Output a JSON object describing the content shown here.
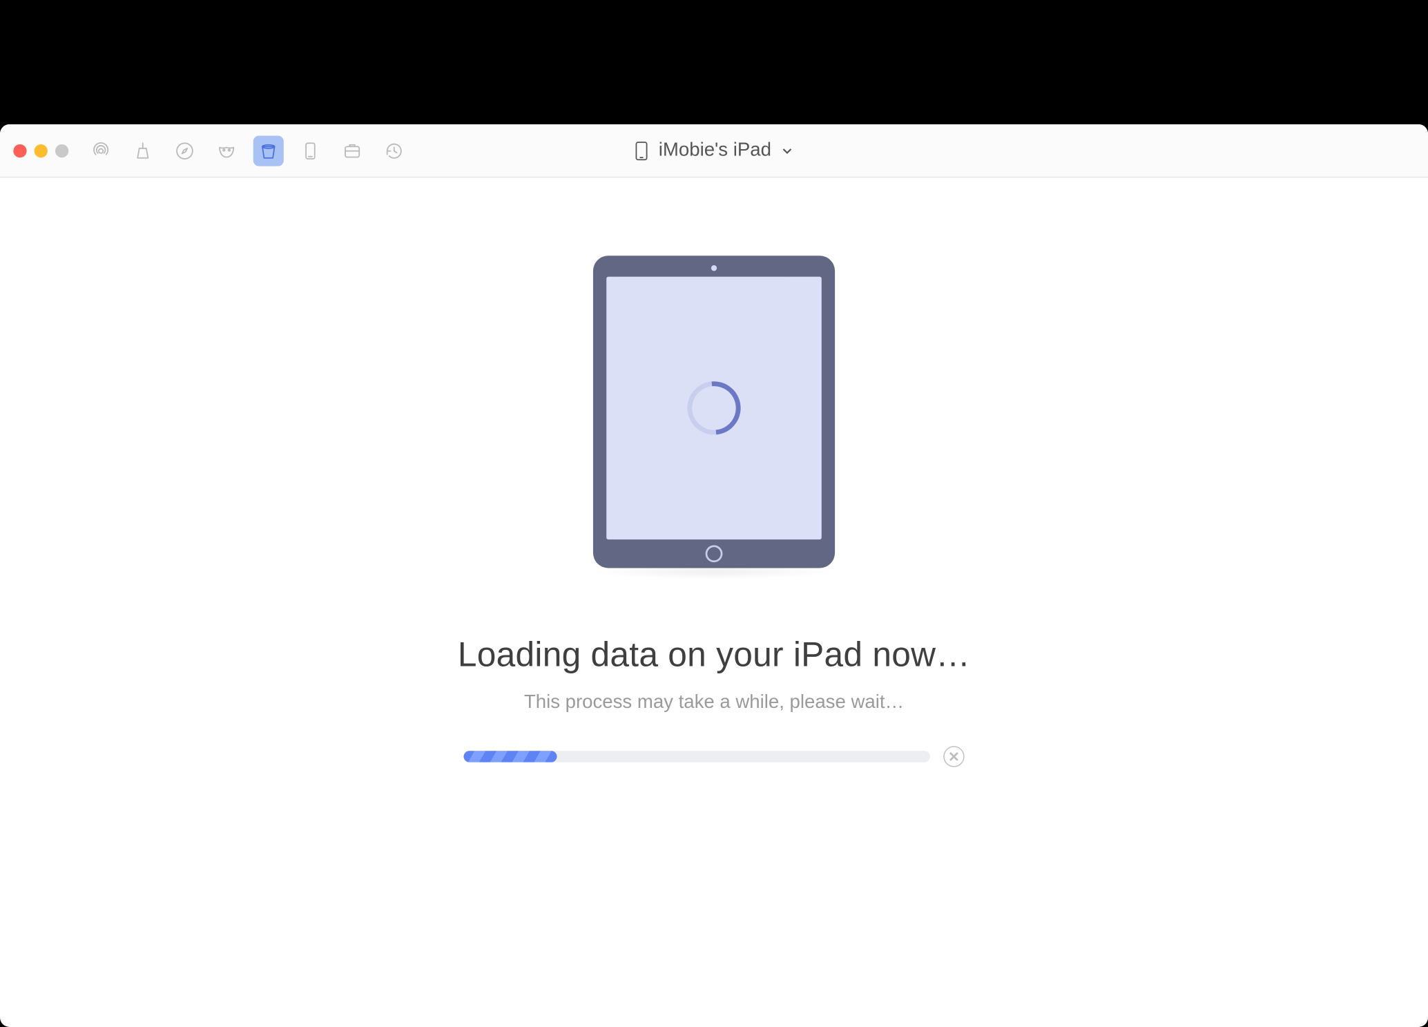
{
  "device": {
    "name": "iMobie's iPad"
  },
  "toolbar": {
    "icons": [
      {
        "id": "airdrop-icon",
        "selected": false
      },
      {
        "id": "clean-icon",
        "selected": false
      },
      {
        "id": "safari-icon",
        "selected": false
      },
      {
        "id": "mask-icon",
        "selected": false
      },
      {
        "id": "bucket-icon",
        "selected": true
      },
      {
        "id": "phone-icon",
        "selected": false
      },
      {
        "id": "archive-icon",
        "selected": false
      },
      {
        "id": "history-icon",
        "selected": false
      }
    ]
  },
  "main": {
    "headline": "Loading data on your iPad now…",
    "subline": "This process may take a while, please wait…",
    "progress_percent": 20
  }
}
